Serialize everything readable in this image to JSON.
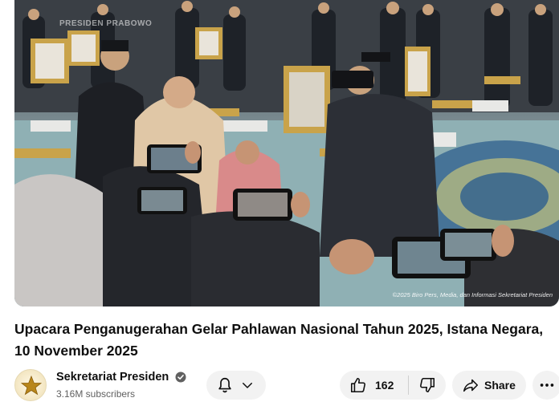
{
  "video": {
    "watermark": "PRESIDEN PRABOWO",
    "copyright": "©2025 Biro Pers, Media, dan Informasi Sekretariat Presiden"
  },
  "title": "Upacara Penganugerahan Gelar Pahlawan Nasional Tahun 2025, Istana Negara, 10 November 2025",
  "channel": {
    "name": "Sekretariat Presiden",
    "subscribers": "3.16M subscribers",
    "avatar_icon": "star-emblem-icon"
  },
  "actions": {
    "subscribe_icons": [
      "bell-icon",
      "chevron-down-icon"
    ],
    "likes": "162",
    "share_label": "Share"
  },
  "colors": {
    "pill_bg": "#f2f2f2",
    "text": "#0f0f0f",
    "secondary_text": "#606060"
  }
}
